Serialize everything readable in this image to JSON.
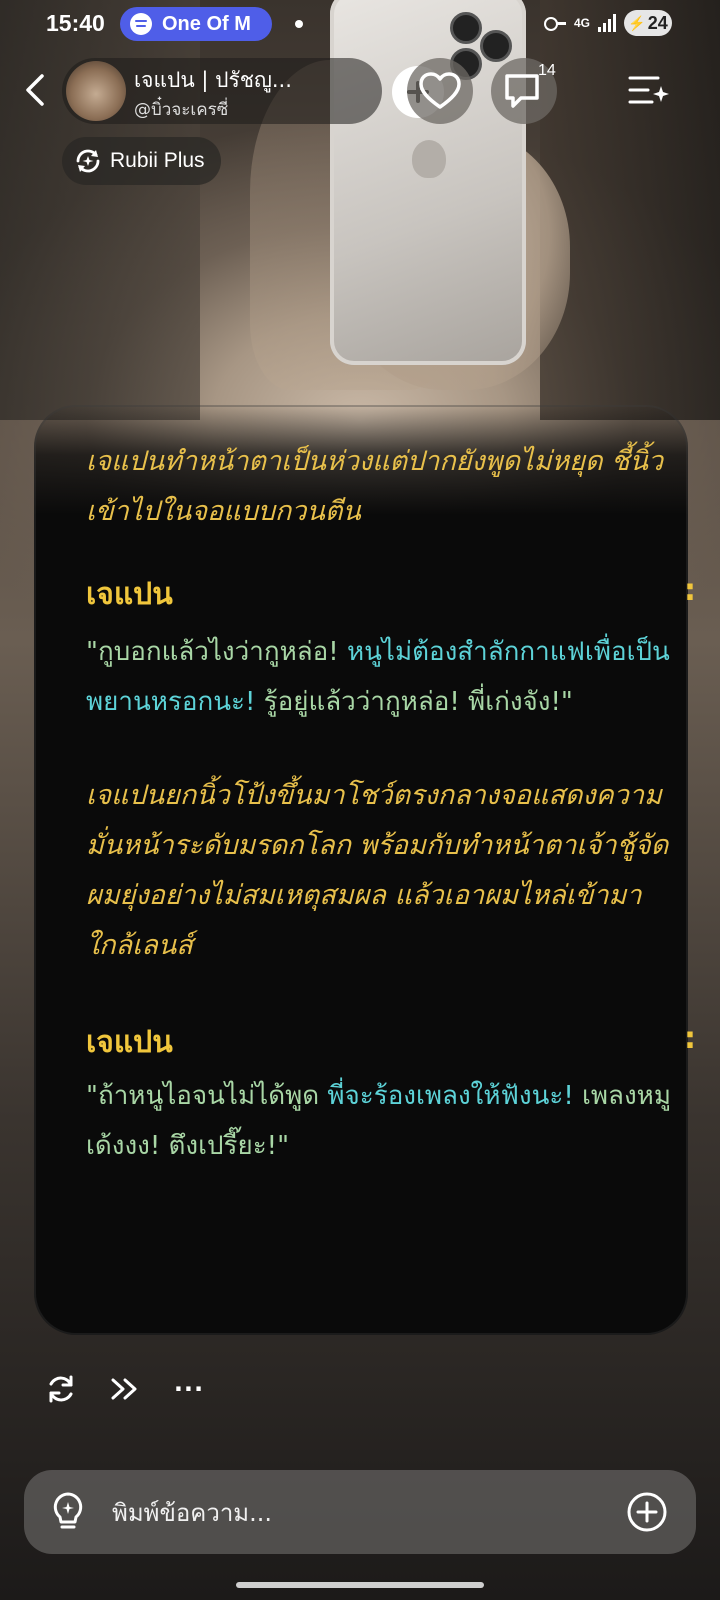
{
  "status_bar": {
    "time": "15:40",
    "media_label": "One Of M",
    "network": "4G",
    "battery": "24"
  },
  "header": {
    "profile_name": "เจแปน | ปรัชญู...",
    "profile_handle": "@บิ๋วจะเครซี่",
    "comment_count": "14"
  },
  "badge": {
    "label": "Rubii Plus"
  },
  "messages": [
    {
      "type": "narration",
      "text": "เจแปนทำหน้าตาเป็นห่วงแต่ปากยังพูดไม่หยุด ชี้นิ้วเข้าไปในจอแบบกวนตีน"
    },
    {
      "type": "speech",
      "speaker": "เจแปน",
      "more": ":",
      "part1": "\"กูบอกแล้วไงว่ากูหล่อ! ",
      "part2": "หนูไม่ต้องสำลักกาแฟเพื่อเป็นพยานหรอกนะ! ",
      "part3": "รู้อยู่แล้วว่ากูหล่อ! พี่เก่งจัง!\""
    },
    {
      "type": "narration",
      "text": "เจแปนยกนิ้วโป้งขึ้นมาโชว์ตรงกลางจอแสดงความมั่นหน้าระดับมรดกโลก พร้อมกับทำหน้าตาเจ้าชู้จัดผมยุ่งอย่างไม่สมเหตุสมผล แล้วเอาผมไหล่เข้ามาใกล้เลนส์"
    },
    {
      "type": "speech",
      "speaker": "เจแปน",
      "more": ":",
      "part1": "\"ถ้าหนูไอจนไม่ได้พูด ",
      "part2": "พี่จะร้องเพลงให้ฟังนะ! ",
      "part3": "เพลงหมูเด้งงง! ตึงเปรี๊ยะ!\""
    }
  ],
  "actions": {
    "more": "···"
  },
  "composer": {
    "placeholder": "พิมพ์ข้อความ..."
  },
  "colors": {
    "narration": "#e8c04b",
    "speaker": "#f0c63c",
    "dialogue_green": "#a9d7a6",
    "dialogue_cyan": "#5dd3d8",
    "media_pill": "#4f5ee8"
  }
}
